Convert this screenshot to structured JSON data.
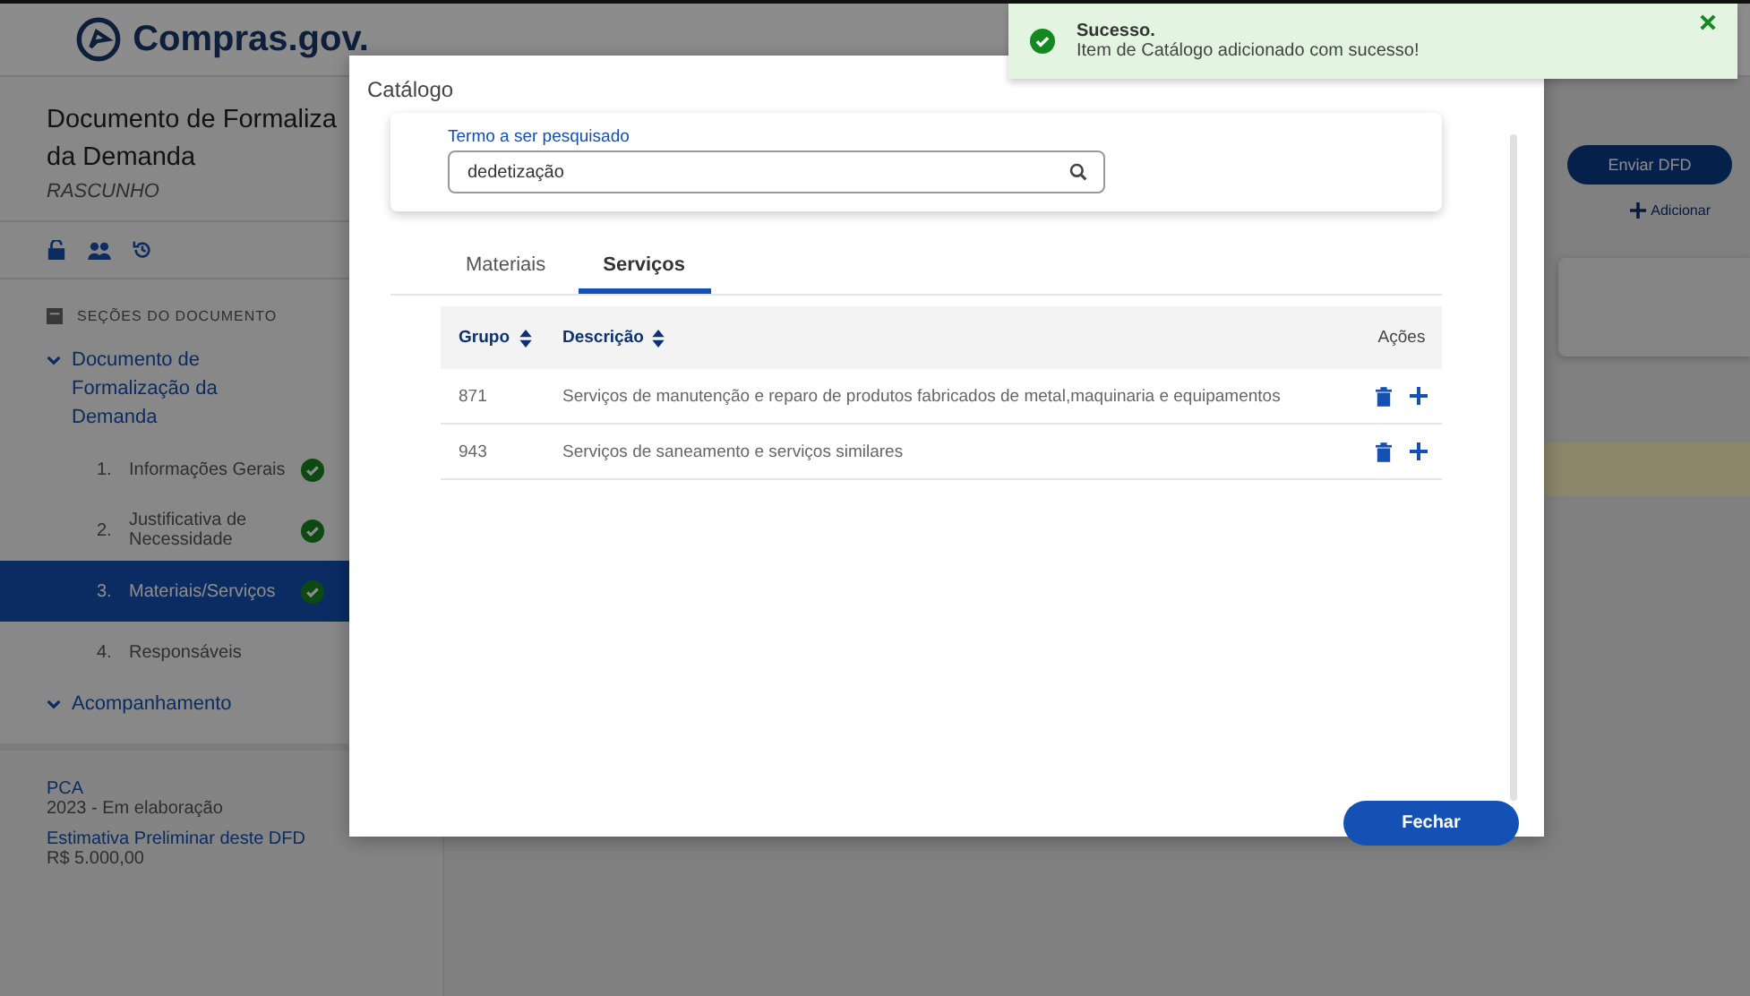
{
  "header": {
    "logo_text": "Compras.gov."
  },
  "sidebar": {
    "title_lines": [
      "Documento de Formaliza",
      "da Demanda"
    ],
    "status": "RASCUNHO",
    "sections_label": "SEÇÕES DO DOCUMENTO",
    "tree": [
      {
        "label": "Documento de Formalização da Demanda",
        "expanded": true,
        "children": [
          {
            "number": "1.",
            "label": "Informações Gerais",
            "done": true,
            "selected": false
          },
          {
            "number": "2.",
            "label": "Justificativa de Necessidade",
            "done": true,
            "selected": false
          },
          {
            "number": "3.",
            "label": "Materiais/Serviços",
            "done": true,
            "selected": true
          },
          {
            "number": "4.",
            "label": "Responsáveis",
            "done": false,
            "selected": false
          }
        ]
      },
      {
        "label": "Acompanhamento",
        "expanded": true
      }
    ],
    "info": [
      {
        "label": "PCA",
        "value": "2023 - Em elaboração"
      },
      {
        "label": "Estimativa Preliminar deste DFD",
        "value": "R$ 5.000,00"
      }
    ]
  },
  "actions": {
    "send_button": "Enviar DFD",
    "add_link": "Adicionar"
  },
  "modal": {
    "title": "Catálogo",
    "search": {
      "label": "Termo a ser pesquisado",
      "value": "dedetização"
    },
    "tabs": [
      {
        "label": "Materiais",
        "selected": false
      },
      {
        "label": "Serviços",
        "selected": true
      }
    ],
    "table": {
      "columns": [
        {
          "label": "Grupo",
          "sortable": true
        },
        {
          "label": "Descrição",
          "sortable": true
        },
        {
          "label": "Ações",
          "sortable": false
        }
      ],
      "rows": [
        {
          "group": "871",
          "description": "Serviços de manutenção e reparo de produtos fabricados de metal,maquinaria e equipamentos"
        },
        {
          "group": "943",
          "description": "Serviços de saneamento e serviços similares"
        }
      ]
    },
    "close_button": "Fechar"
  },
  "toast": {
    "kind": "success",
    "title": "Sucesso.",
    "message": "Item de Catálogo adicionado com sucesso!"
  }
}
